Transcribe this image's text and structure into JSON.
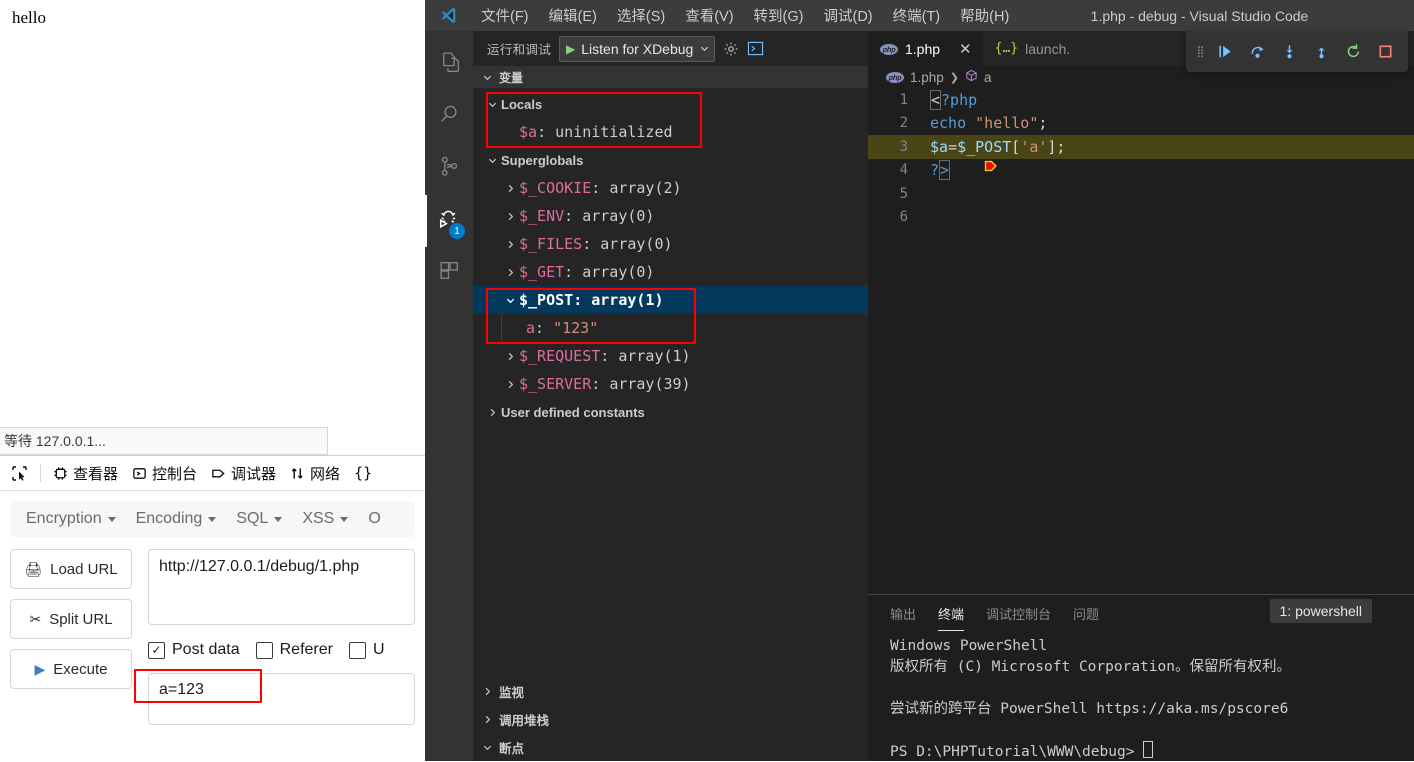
{
  "browser": {
    "page_text": "hello",
    "status_text": "等待 127.0.0.1..."
  },
  "devtools": {
    "picker_icon": "element-picker-icon",
    "tabs": [
      {
        "label": "查看器",
        "icon": "inspector-icon"
      },
      {
        "label": "控制台",
        "icon": "console-icon"
      },
      {
        "label": "调试器",
        "icon": "debugger-icon"
      },
      {
        "label": "网络",
        "icon": "network-icon"
      },
      {
        "label": "{}",
        "icon": "style-editor-icon"
      }
    ]
  },
  "hackbar": {
    "menu": [
      "Encryption",
      "Encoding",
      "SQL",
      "XSS",
      "O"
    ],
    "buttons": [
      {
        "label": "Load URL",
        "icon": "load-url-icon"
      },
      {
        "label": "Split URL",
        "icon": "split-url-icon"
      },
      {
        "label": "Execute",
        "icon": "execute-icon"
      }
    ],
    "url_value": "http://127.0.0.1/debug/1.php",
    "checkboxes": [
      {
        "label": "Post data",
        "checked": true
      },
      {
        "label": "Referer",
        "checked": false
      },
      {
        "label": "U",
        "checked": false
      }
    ],
    "post_data_value": "a=123",
    "highlight_color": "#ff0000"
  },
  "vscode": {
    "title": "1.php - debug - Visual Studio Code",
    "logo_icon": "vscode-logo-icon",
    "menu": [
      "文件(F)",
      "编辑(E)",
      "选择(S)",
      "查看(V)",
      "转到(G)",
      "调试(D)",
      "终端(T)",
      "帮助(H)"
    ],
    "activitybar": [
      {
        "name": "explorer",
        "icon": "files-icon",
        "active": false,
        "badge": ""
      },
      {
        "name": "search",
        "icon": "search-icon",
        "active": false,
        "badge": ""
      },
      {
        "name": "source-control",
        "icon": "source-control-icon",
        "active": false,
        "badge": ""
      },
      {
        "name": "run-and-debug",
        "icon": "run-debug-icon",
        "active": true,
        "badge": "1"
      },
      {
        "name": "extensions",
        "icon": "extensions-icon",
        "active": false,
        "badge": ""
      }
    ],
    "sidebar": {
      "title": "运行和调试",
      "config_name": "Listen for XDebug",
      "start_icon": "play-icon",
      "gear_icon": "gear-icon",
      "terminal_icon": "open-debug-console-icon",
      "variables_section": "变量",
      "scopes": [
        {
          "label": "Locals",
          "expanded": true,
          "highlighted": true
        },
        {
          "label": "Superglobals",
          "expanded": true,
          "highlighted": false
        }
      ],
      "locals": [
        {
          "name": "$a",
          "value": "uninitialized",
          "kind": "uninit"
        }
      ],
      "superglobals": [
        {
          "name": "$_COOKIE",
          "value": "array(2)",
          "expanded": false,
          "selected": false
        },
        {
          "name": "$_ENV",
          "value": "array(0)",
          "expanded": false,
          "selected": false
        },
        {
          "name": "$_FILES",
          "value": "array(0)",
          "expanded": false,
          "selected": false
        },
        {
          "name": "$_GET",
          "value": "array(0)",
          "expanded": false,
          "selected": false
        },
        {
          "name": "$_POST",
          "value": "array(1)",
          "expanded": true,
          "selected": true
        },
        {
          "name": "$_REQUEST",
          "value": "array(1)",
          "expanded": false,
          "selected": false
        },
        {
          "name": "$_SERVER",
          "value": "array(39)",
          "expanded": false,
          "selected": false
        }
      ],
      "post_children": [
        {
          "name": "a",
          "value": "\"123\""
        }
      ],
      "user_constants": "User defined constants",
      "bottom_sections": [
        {
          "label": "监视",
          "expanded": false
        },
        {
          "label": "调用堆栈",
          "expanded": false
        },
        {
          "label": "断点",
          "expanded": true
        }
      ]
    },
    "tabs": [
      {
        "label": "1.php",
        "icon": "php-file-icon",
        "active": true,
        "closable": true
      },
      {
        "label": "launch.",
        "icon": "json-file-icon",
        "active": false,
        "closable": false
      }
    ],
    "debug_toolbar": [
      {
        "name": "drag-handle",
        "icon": "grip-icon",
        "color": "#8a8a8a"
      },
      {
        "name": "continue",
        "icon": "continue-icon",
        "color": "#75beff"
      },
      {
        "name": "step-over",
        "icon": "step-over-icon",
        "color": "#75beff"
      },
      {
        "name": "step-into",
        "icon": "step-into-icon",
        "color": "#75beff"
      },
      {
        "name": "step-out",
        "icon": "step-out-icon",
        "color": "#75beff"
      },
      {
        "name": "restart",
        "icon": "restart-icon",
        "color": "#89d185"
      },
      {
        "name": "stop",
        "icon": "stop-icon",
        "color": "#f48771"
      }
    ],
    "breadcrumb": [
      "1.php",
      "a"
    ],
    "editor": {
      "highlight_line": 3,
      "breakpoint_line": 3,
      "lines": [
        {
          "num": "1",
          "text": "<?php"
        },
        {
          "num": "2",
          "text": "echo \"hello\";"
        },
        {
          "num": "3",
          "text": "$a=$_POST['a'];"
        },
        {
          "num": "4",
          "text": "?>"
        },
        {
          "num": "5",
          "text": ""
        },
        {
          "num": "6",
          "text": ""
        }
      ]
    },
    "panel": {
      "tabs": [
        "输出",
        "终端",
        "调试控制台",
        "问题"
      ],
      "active_tab": "终端",
      "terminal_select": "1: powershell",
      "terminal_lines": [
        "Windows PowerShell",
        "版权所有 (C) Microsoft Corporation。保留所有权利。",
        "",
        "尝试新的跨平台 PowerShell https://aka.ms/pscore6",
        "",
        "PS D:\\PHPTutorial\\WWW\\debug>"
      ]
    }
  }
}
